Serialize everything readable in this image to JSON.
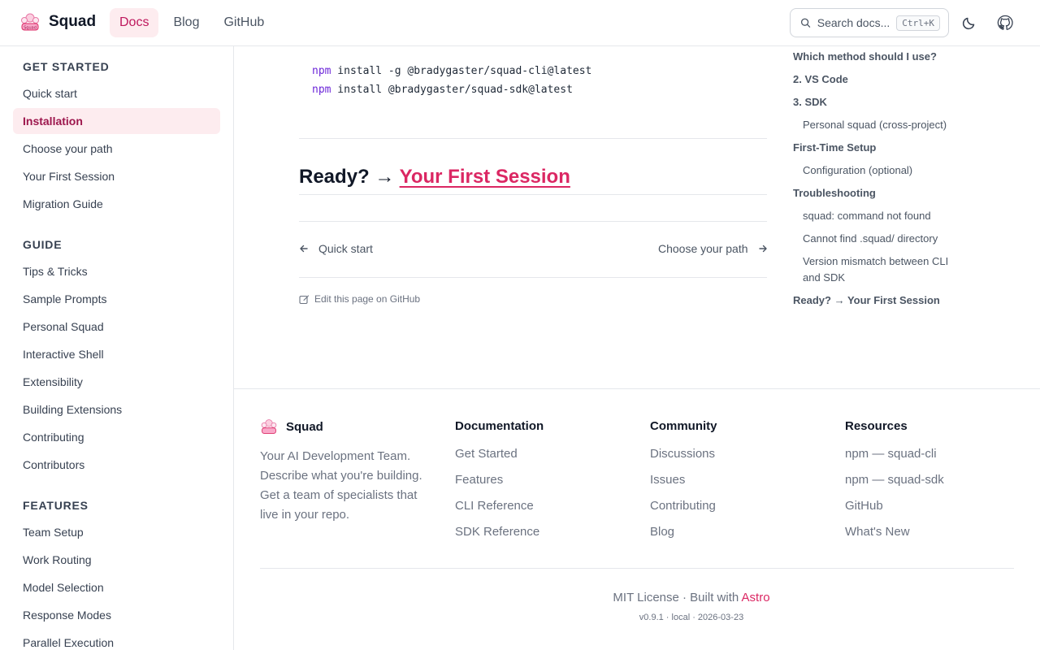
{
  "header": {
    "brand": "Squad",
    "nav": [
      {
        "label": "Docs",
        "active": true
      },
      {
        "label": "Blog",
        "active": false
      },
      {
        "label": "GitHub",
        "active": false
      }
    ],
    "search_placeholder": "Search docs...",
    "search_shortcut": "Ctrl+K",
    "icons": {
      "search": "search-icon",
      "theme": "moon-icon",
      "github": "github-icon"
    }
  },
  "sidebar": {
    "sections": [
      {
        "title": "GET STARTED",
        "items": [
          "Quick start",
          "Installation",
          "Choose your path",
          "Your First Session",
          "Migration Guide"
        ]
      },
      {
        "title": "GUIDE",
        "items": [
          "Tips & Tricks",
          "Sample Prompts",
          "Personal Squad",
          "Interactive Shell",
          "Extensibility",
          "Building Extensions",
          "Contributing",
          "Contributors"
        ]
      },
      {
        "title": "FEATURES",
        "items": [
          "Team Setup",
          "Work Routing",
          "Model Selection",
          "Response Modes",
          "Parallel Execution"
        ]
      }
    ],
    "active_item": "Installation"
  },
  "content": {
    "code_lines": [
      {
        "cmd": "npm",
        "rest": " install -g @bradygaster/squad-cli@latest"
      },
      {
        "cmd": "npm",
        "rest": " install @bradygaster/squad-sdk@latest"
      }
    ],
    "ready_prefix": "Ready? →",
    "ready_link": "Your First Session",
    "prev_label": "Quick start",
    "next_label": "Choose your path",
    "edit_label": "Edit this page on GitHub"
  },
  "toc": [
    {
      "label": "Which method should I use?",
      "level": 1
    },
    {
      "label": "2. VS Code",
      "level": 1
    },
    {
      "label": "3. SDK",
      "level": 1
    },
    {
      "label": "Personal squad (cross-project)",
      "level": 2
    },
    {
      "label": "First-Time Setup",
      "level": 1
    },
    {
      "label": "Configuration (optional)",
      "level": 2
    },
    {
      "label": "Troubleshooting",
      "level": 1
    },
    {
      "label": "squad: command not found",
      "level": 2
    },
    {
      "label": "Cannot find .squad/ directory",
      "level": 2
    },
    {
      "label": "Version mismatch between CLI and SDK",
      "level": 2
    },
    {
      "label": "Ready? → Your First Session",
      "level": 1
    }
  ],
  "footer": {
    "brand": "Squad",
    "description": "Your AI Development Team. Describe what you're building. Get a team of specialists that live in your repo.",
    "columns": [
      {
        "title": "Documentation",
        "links": [
          "Get Started",
          "Features",
          "CLI Reference",
          "SDK Reference"
        ]
      },
      {
        "title": "Community",
        "links": [
          "Discussions",
          "Issues",
          "Contributing",
          "Blog"
        ]
      },
      {
        "title": "Resources",
        "links": [
          "npm — squad-cli",
          "npm — squad-sdk",
          "GitHub",
          "What's New"
        ]
      }
    ],
    "license_prefix": "MIT License · Built with ",
    "license_link": "Astro",
    "version": "v0.9.1 · local · 2026-03-23"
  },
  "colors": {
    "accent": "#db2763",
    "active_bg": "#fdecef",
    "border": "#e5e7eb"
  }
}
